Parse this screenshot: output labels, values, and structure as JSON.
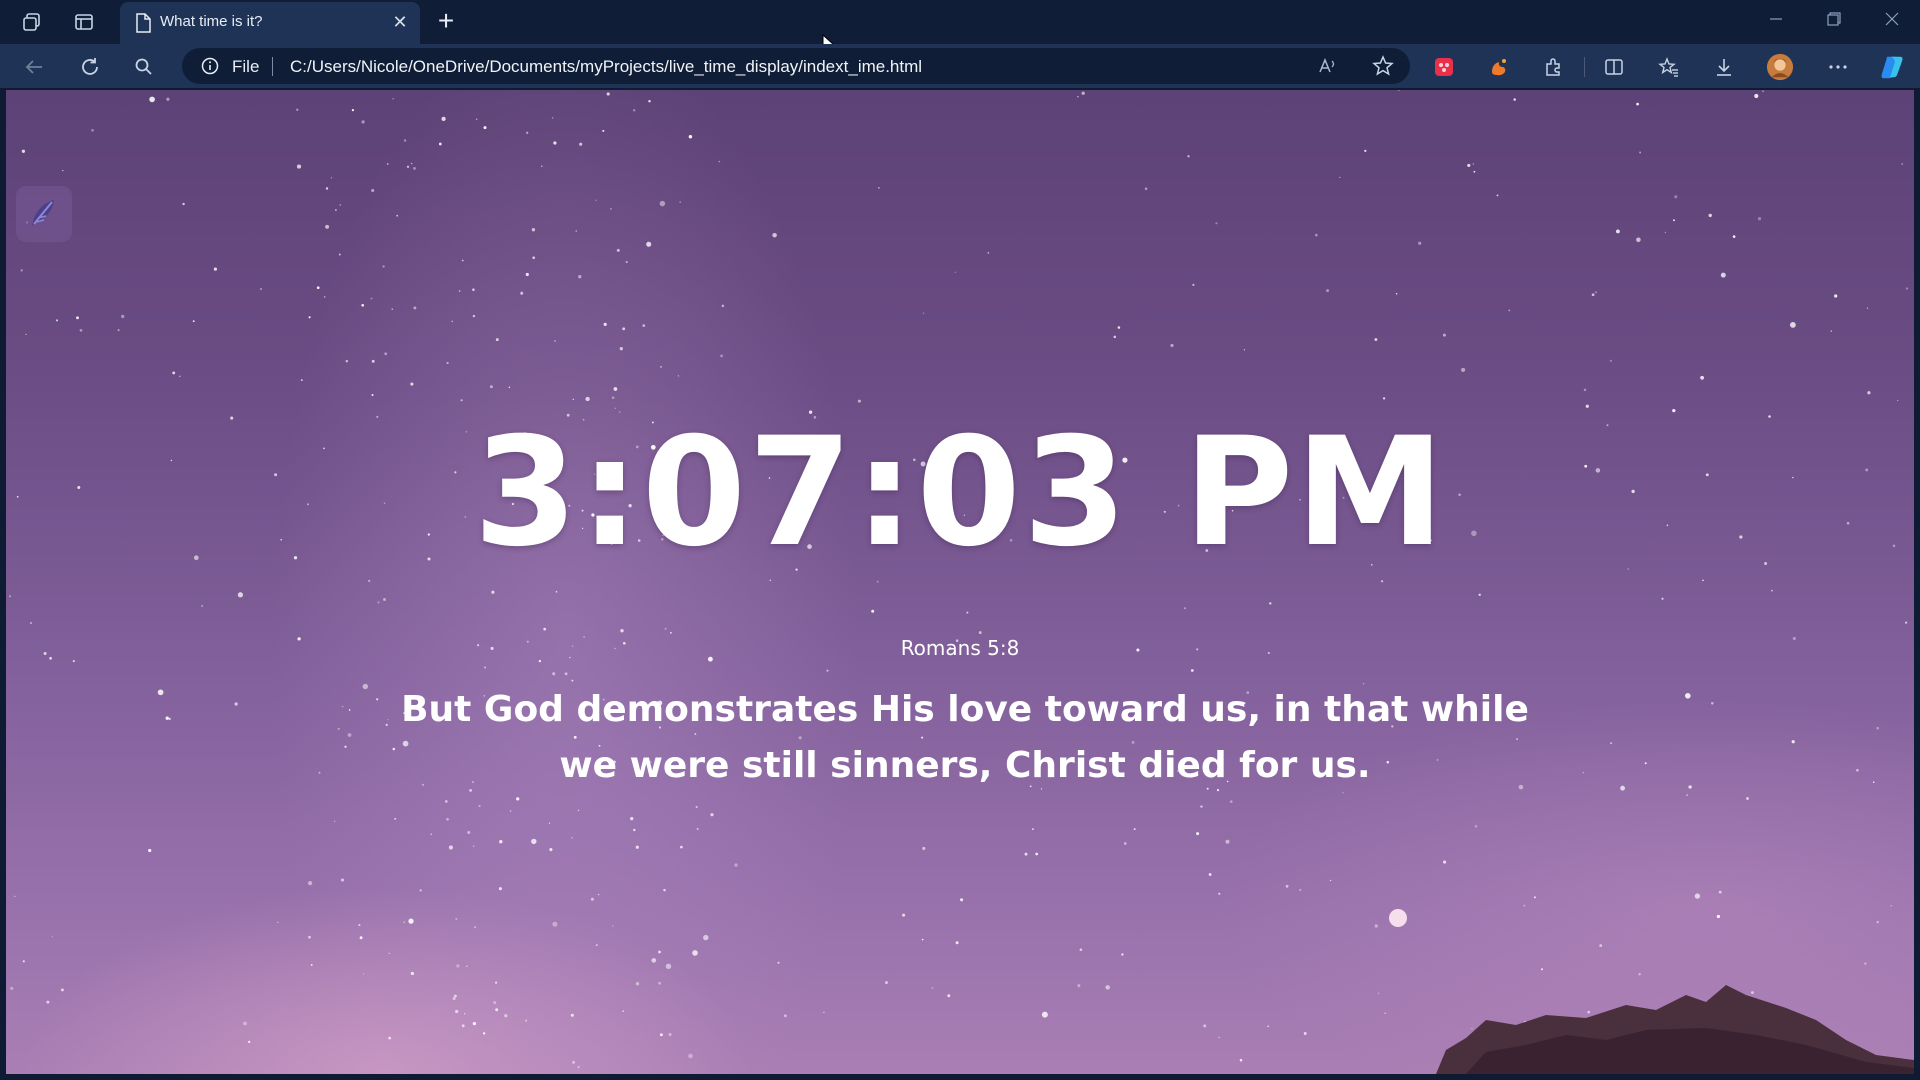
{
  "browser": {
    "tab": {
      "title": "What time is it?",
      "close_label": "✕"
    },
    "new_tab_label": "+",
    "address": {
      "scheme": "File",
      "url": "C:/Users/Nicole/OneDrive/Documents/myProjects/live_time_display/indext_ime.html"
    }
  },
  "page": {
    "clock": "3:07:03 PM",
    "reference": "Romans 5:8",
    "verse": "But God demonstrates His love toward us, in that while we were still sinners, Christ died for us."
  },
  "colors": {
    "browser_chrome": "#0f1d36",
    "active_tab": "#1f3356",
    "sky_top": "#5c4276",
    "sky_bottom": "#a97fb4",
    "text": "#ffffff"
  },
  "icons": [
    "workspaces-icon",
    "tab-actions-icon",
    "page-icon",
    "close-icon",
    "plus-icon",
    "minimize-icon",
    "restore-icon",
    "window-close-icon",
    "back-icon",
    "refresh-icon",
    "search-icon",
    "info-icon",
    "read-aloud-icon",
    "favorite-star-icon",
    "extension-red-icon",
    "extension-orange-icon",
    "extensions-icon",
    "split-screen-icon",
    "favorites-icon",
    "downloads-icon",
    "profile-avatar",
    "more-icon",
    "copilot-icon",
    "feather-icon"
  ]
}
